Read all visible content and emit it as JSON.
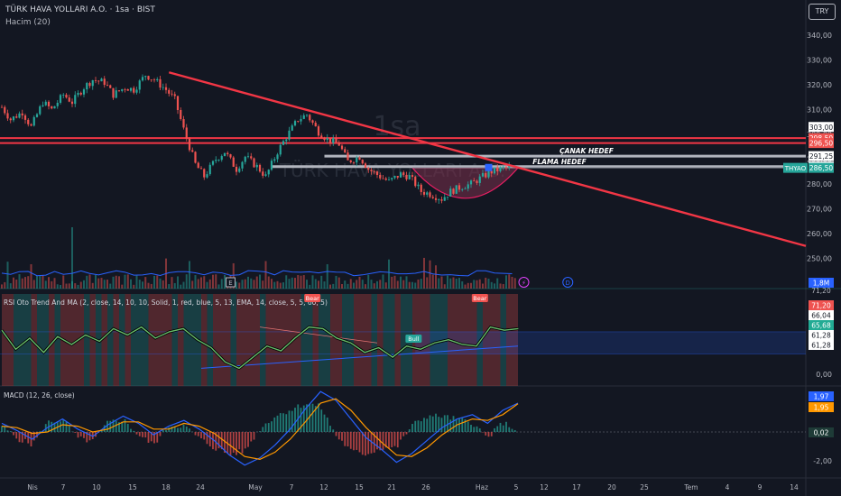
{
  "header": {
    "title": "TÜRK HAVA YOLLARI A.O. · 1sa · BIST",
    "volume": "Hacim (20)",
    "currency": "TRY",
    "watermark_big": "1sa",
    "watermark_name": "TÜRK HAVA YOLLARI A.O."
  },
  "colors": {
    "background": "#131722",
    "up": "#26a69a",
    "down": "#ef5350",
    "trendline": "#f23645",
    "blue": "#2962ff",
    "orange": "#ff9800"
  },
  "chart_data": [
    {
      "type": "candlestick",
      "title": "TÜRK HAVA YOLLARI A.O. · 1sa · BIST",
      "ylim": [
        248,
        348
      ],
      "y_ticks": [
        "340,00",
        "330,00",
        "320,00",
        "310,00",
        "300,00",
        "290,00",
        "280,00",
        "270,00",
        "260,00",
        "250,00"
      ],
      "x_ticks": [
        "Nis",
        "7",
        "10",
        "15",
        "18",
        "24",
        "May",
        "7",
        "12",
        "15",
        "21",
        "26",
        "Haz",
        "5",
        "12",
        "17",
        "20",
        "25",
        "Tem",
        "4",
        "9",
        "14"
      ],
      "close_path": [
        {
          "t": 0,
          "v": 311
        },
        {
          "t": 3,
          "v": 306
        },
        {
          "t": 7,
          "v": 309
        },
        {
          "t": 10,
          "v": 303
        },
        {
          "t": 14,
          "v": 313
        },
        {
          "t": 17,
          "v": 310
        },
        {
          "t": 21,
          "v": 316
        },
        {
          "t": 24,
          "v": 313
        },
        {
          "t": 28,
          "v": 319
        },
        {
          "t": 31,
          "v": 322
        },
        {
          "t": 35,
          "v": 321
        },
        {
          "t": 38,
          "v": 316
        },
        {
          "t": 42,
          "v": 319
        },
        {
          "t": 45,
          "v": 318
        },
        {
          "t": 49,
          "v": 324
        },
        {
          "t": 52,
          "v": 322
        },
        {
          "t": 56,
          "v": 318
        },
        {
          "t": 59,
          "v": 314
        },
        {
          "t": 62,
          "v": 302
        },
        {
          "t": 66,
          "v": 288
        },
        {
          "t": 69,
          "v": 283
        },
        {
          "t": 73,
          "v": 290
        },
        {
          "t": 76,
          "v": 293
        },
        {
          "t": 80,
          "v": 286
        },
        {
          "t": 83,
          "v": 291
        },
        {
          "t": 87,
          "v": 287
        },
        {
          "t": 90,
          "v": 283
        },
        {
          "t": 94,
          "v": 293
        },
        {
          "t": 97,
          "v": 299
        },
        {
          "t": 101,
          "v": 306
        },
        {
          "t": 104,
          "v": 308
        },
        {
          "t": 108,
          "v": 301
        },
        {
          "t": 111,
          "v": 298
        },
        {
          "t": 115,
          "v": 296
        },
        {
          "t": 118,
          "v": 289
        },
        {
          "t": 122,
          "v": 291
        },
        {
          "t": 125,
          "v": 286
        },
        {
          "t": 129,
          "v": 283
        },
        {
          "t": 132,
          "v": 281
        },
        {
          "t": 136,
          "v": 284
        },
        {
          "t": 139,
          "v": 283
        },
        {
          "t": 143,
          "v": 277
        },
        {
          "t": 146,
          "v": 276
        },
        {
          "t": 150,
          "v": 274
        },
        {
          "t": 153,
          "v": 277
        },
        {
          "t": 157,
          "v": 279
        },
        {
          "t": 160,
          "v": 280
        },
        {
          "t": 164,
          "v": 283
        },
        {
          "t": 167,
          "v": 285
        },
        {
          "t": 170,
          "v": 286
        },
        {
          "t": 174,
          "v": 287
        }
      ],
      "price_labels": [
        {
          "text": "303,00",
          "value": 303.0,
          "kind": "level"
        },
        {
          "text": "298,50",
          "value": 298.5,
          "kind": "red"
        },
        {
          "text": "296,50",
          "value": 296.5,
          "kind": "red"
        },
        {
          "text": "291,25",
          "value": 291.25,
          "kind": "level"
        },
        {
          "text": "287,00",
          "value": 287.0,
          "kind": "level"
        },
        {
          "text": "286,50",
          "value": 286.5,
          "kind": "last",
          "ticker": "THYAO"
        }
      ],
      "annotations": {
        "canak": "ÇANAK HEDEF",
        "flama": "FLAMA HEDEF",
        "canak_level": 291.25,
        "flama_level": 287.0,
        "support_levels": [
          296.5,
          298.5
        ],
        "trend_start": {
          "t": 57,
          "v": 325
        },
        "trend_end": {
          "t": 220,
          "v": 255
        },
        "event_marks": [
          "E",
          "⚡",
          "D"
        ]
      },
      "volume": {
        "label": "1,8M",
        "right_label": "71,20"
      }
    },
    {
      "type": "line",
      "title": "RSI Oto Trend And MA (2, close, 14, 10, 10, Solid, 1, red, blue, 5, 13, EMA, 14, close, 5, 5, 60, 5)",
      "ylim": [
        0,
        100
      ],
      "y_ticks": [
        "0,00"
      ],
      "right_labels": [
        {
          "text": "71,20",
          "value": 71.2,
          "kind": "red"
        },
        {
          "text": "66,04",
          "value": 66.04,
          "kind": "plain"
        },
        {
          "text": "65,68",
          "value": 65.68,
          "kind": "green"
        },
        {
          "text": "61,28",
          "value": 61.28,
          "kind": "plain"
        },
        {
          "text": "61,28",
          "value": 61.28,
          "kind": "plain2"
        }
      ],
      "signals": [
        {
          "text": "Bear",
          "t": 89,
          "kind": "bear"
        },
        {
          "text": "Bull",
          "t": 118,
          "kind": "bull"
        },
        {
          "text": "Bear",
          "t": 137,
          "kind": "bear"
        }
      ],
      "rsi_series": [
        {
          "t": 0,
          "v": 68
        },
        {
          "t": 4,
          "v": 44
        },
        {
          "t": 8,
          "v": 58
        },
        {
          "t": 12,
          "v": 40
        },
        {
          "t": 16,
          "v": 60
        },
        {
          "t": 20,
          "v": 50
        },
        {
          "t": 24,
          "v": 62
        },
        {
          "t": 28,
          "v": 54
        },
        {
          "t": 32,
          "v": 70
        },
        {
          "t": 36,
          "v": 62
        },
        {
          "t": 40,
          "v": 72
        },
        {
          "t": 44,
          "v": 58
        },
        {
          "t": 48,
          "v": 66
        },
        {
          "t": 52,
          "v": 70
        },
        {
          "t": 56,
          "v": 56
        },
        {
          "t": 60,
          "v": 46
        },
        {
          "t": 64,
          "v": 28
        },
        {
          "t": 68,
          "v": 20
        },
        {
          "t": 72,
          "v": 34
        },
        {
          "t": 76,
          "v": 48
        },
        {
          "t": 80,
          "v": 42
        },
        {
          "t": 84,
          "v": 58
        },
        {
          "t": 88,
          "v": 72
        },
        {
          "t": 92,
          "v": 70
        },
        {
          "t": 96,
          "v": 58
        },
        {
          "t": 100,
          "v": 52
        },
        {
          "t": 104,
          "v": 40
        },
        {
          "t": 108,
          "v": 46
        },
        {
          "t": 112,
          "v": 34
        },
        {
          "t": 116,
          "v": 48
        },
        {
          "t": 120,
          "v": 44
        },
        {
          "t": 124,
          "v": 52
        },
        {
          "t": 128,
          "v": 56
        },
        {
          "t": 132,
          "v": 50
        },
        {
          "t": 136,
          "v": 48
        },
        {
          "t": 140,
          "v": 72
        },
        {
          "t": 144,
          "v": 68
        },
        {
          "t": 148,
          "v": 70
        }
      ]
    },
    {
      "type": "line",
      "title": "MACD (12, 26, close)",
      "ylim": [
        -3,
        3
      ],
      "y_ticks": [
        "-2,00"
      ],
      "right_labels": [
        {
          "text": "1,97",
          "value": 1.97,
          "kind": "blue"
        },
        {
          "text": "1,95",
          "value": 1.95,
          "kind": "orange"
        },
        {
          "text": "0,02",
          "value": 0.02,
          "kind": "teal"
        }
      ],
      "series": [
        {
          "name": "MACD",
          "values": [
            0.6,
            0.1,
            -0.5,
            0.3,
            0.9,
            0.2,
            -0.3,
            0.5,
            1.1,
            0.6,
            -0.2,
            0.4,
            0.8,
            0.2,
            -0.6,
            -1.6,
            -2.3,
            -1.8,
            -0.9,
            0.2,
            1.6,
            2.8,
            2.2,
            0.9,
            -0.4,
            -1.2,
            -2.1,
            -1.5,
            -0.6,
            0.3,
            0.9,
            1.2,
            0.6,
            1.5,
            2.0
          ]
        },
        {
          "name": "Signal",
          "values": [
            0.4,
            0.3,
            -0.1,
            0.0,
            0.5,
            0.4,
            0.0,
            0.2,
            0.7,
            0.7,
            0.2,
            0.2,
            0.6,
            0.4,
            -0.1,
            -0.9,
            -1.7,
            -1.9,
            -1.4,
            -0.5,
            0.7,
            2.0,
            2.3,
            1.5,
            0.3,
            -0.7,
            -1.6,
            -1.7,
            -1.1,
            -0.2,
            0.5,
            0.9,
            0.8,
            1.2,
            1.95
          ]
        }
      ]
    }
  ]
}
